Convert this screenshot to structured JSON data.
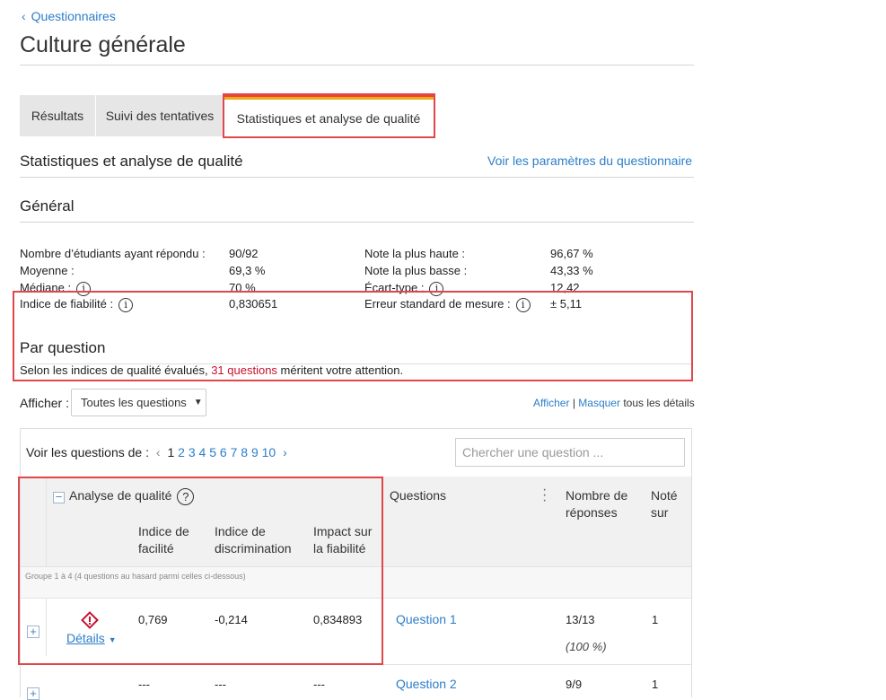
{
  "nav": {
    "back_icon": "‹",
    "back_label": "Questionnaires"
  },
  "page": {
    "title": "Culture générale"
  },
  "tabs": [
    {
      "label": "Résultats"
    },
    {
      "label": "Suivi des tentatives"
    },
    {
      "label": "Statistiques et analyse de qualité"
    }
  ],
  "section": {
    "title": "Statistiques et analyse de qualité",
    "settings_link": "Voir les paramètres du questionnaire"
  },
  "general": {
    "title": "Général",
    "left": [
      {
        "label": "Nombre d’étudiants ayant répondu :",
        "value": "90/92"
      },
      {
        "label": "Moyenne :",
        "value": "69,3 %"
      },
      {
        "label": "Médiane :",
        "value": "70 %"
      },
      {
        "label": "Indice de fiabilité :",
        "value": "0,830651"
      }
    ],
    "right": [
      {
        "label": "Note la plus haute :",
        "value": "96,67 %"
      },
      {
        "label": "Note la plus basse :",
        "value": "43,33 %"
      },
      {
        "label": "Écart-type :",
        "value": "12,42"
      },
      {
        "label": "Erreur standard de mesure :",
        "value": "± 5,11"
      }
    ]
  },
  "per_question": {
    "title": "Par question",
    "summary_prefix": "Selon les indices de qualité évalués, ",
    "summary_count": "31 questions",
    "summary_suffix": " méritent votre attention."
  },
  "filter": {
    "label": "Afficher :",
    "selected": "Toutes les questions"
  },
  "details_toggle": {
    "show": "Afficher",
    "sep": "|",
    "hide": "Masquer",
    "suffix": "tous les détails"
  },
  "pager": {
    "label": "Voir les questions de :",
    "current": "1",
    "pages": [
      "2",
      "3",
      "4",
      "5",
      "6",
      "7",
      "8",
      "9",
      "10"
    ]
  },
  "search": {
    "placeholder": "Chercher une question ..."
  },
  "table": {
    "quality_header": "Analyse de qualité",
    "col_facility": "Indice de facilité",
    "col_discrimination": "Indice de discrimination",
    "col_impact": "Impact sur la fiabilité",
    "col_questions": "Questions",
    "col_responses": "Nombre de réponses",
    "col_score": "Noté sur",
    "group_label": "Groupe 1 à 4 (4 questions au hasard parmi celles ci-dessous)",
    "rows": [
      {
        "details": "Détails",
        "facility": "0,769",
        "discrimination": "-0,214",
        "impact": "0,834893",
        "question": "Question 1",
        "responses": "13/13",
        "responses_pct": "(100 %)",
        "score": "1"
      },
      {
        "facility": "---",
        "discrimination": "---",
        "impact": "---",
        "question": "Question 2",
        "responses": "9/9",
        "score": "1"
      }
    ]
  },
  "colors": {
    "accent": "#2c7ec9",
    "warning": "#c8102e",
    "highlight": "#e0474c",
    "tab_top": "#f3a81c"
  }
}
